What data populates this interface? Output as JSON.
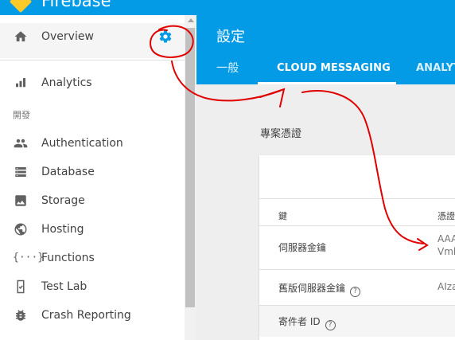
{
  "brand": {
    "name": "Firebase"
  },
  "sidebar": {
    "overview": {
      "label": "Overview",
      "icon": "home-icon"
    },
    "settings_icon": "gear-icon",
    "section_label": "開發",
    "items": [
      {
        "label": "Analytics",
        "icon": "bar-chart-icon"
      },
      {
        "label": "Authentication",
        "icon": "people-icon"
      },
      {
        "label": "Database",
        "icon": "storage-icon"
      },
      {
        "label": "Storage",
        "icon": "photo-icon"
      },
      {
        "label": "Hosting",
        "icon": "globe-icon"
      },
      {
        "label": "Functions",
        "icon": "functions-icon"
      },
      {
        "label": "Test Lab",
        "icon": "phone-check-icon"
      },
      {
        "label": "Crash Reporting",
        "icon": "bug-icon"
      }
    ]
  },
  "header": {
    "title": "設定",
    "tabs": [
      {
        "label": "一般"
      },
      {
        "label": "CLOUD MESSAGING"
      },
      {
        "label": "ANALYTICS"
      }
    ]
  },
  "main": {
    "section_title": "專案憑證",
    "table": {
      "headers": {
        "key": "鍵",
        "credential": "憑證"
      },
      "rows": [
        {
          "key": "伺服器金鑰",
          "value_line1": "AAA",
          "value_line2": "Vml"
        },
        {
          "key": "舊版伺服器金鑰",
          "value": "AIza"
        },
        {
          "key": "寄件者 ID"
        }
      ]
    }
  },
  "colors": {
    "accent": "#039be5",
    "annotation": "#e00000",
    "logo": "#ffca28"
  }
}
